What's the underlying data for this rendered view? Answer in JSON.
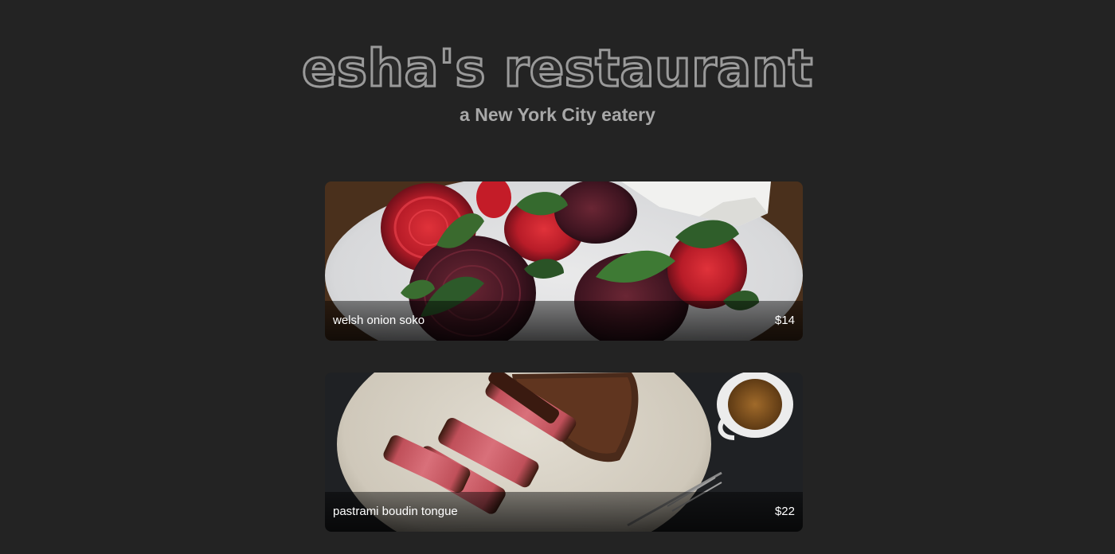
{
  "header": {
    "title": "esha's restaurant",
    "subtitle": "a New York City eatery"
  },
  "menu": {
    "items": [
      {
        "name": "welsh onion soko",
        "price": "$14",
        "image": "roasted-beets-photo"
      },
      {
        "name": "pastrami boudin tongue",
        "price": "$22",
        "image": "sliced-steak-photo"
      }
    ]
  },
  "colors": {
    "background": "#232323",
    "title_outline": "#9a9a9a",
    "subtitle": "#a8a8a8",
    "caption_text": "#ffffff"
  }
}
